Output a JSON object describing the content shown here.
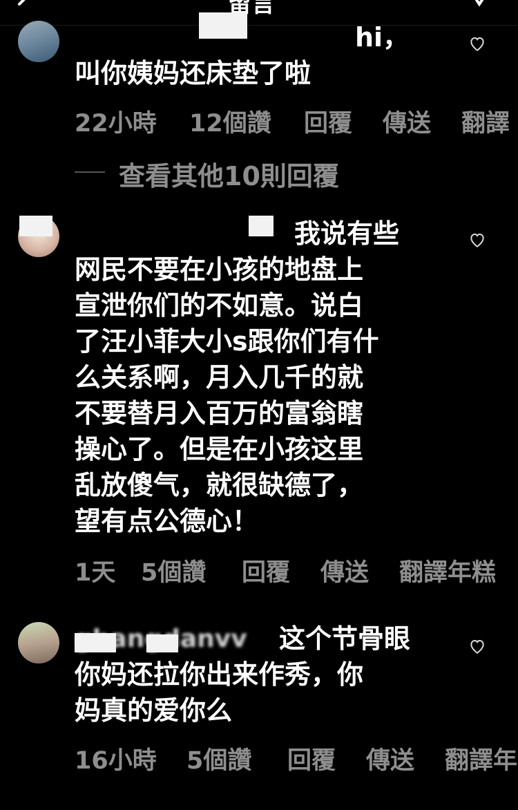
{
  "header": {
    "title": "留言"
  },
  "view_more": "查看其他10則回覆",
  "comments": [
    {
      "lines": [
        "hi，",
        "叫你姨妈还床垫了啦"
      ],
      "meta": {
        "time": "22小時",
        "likes": "12個讚",
        "reply": "回覆",
        "send": "傳送",
        "translate": "翻譯"
      }
    },
    {
      "lines": [
        "我说有些",
        "网民不要在小孩的地盘上",
        "宣泄你们的不如意。说白",
        "了汪小菲大小s跟你们有什",
        "么关系啊，月入几千的就",
        "不要替月入百万的富翁瞎",
        "操心了。但是在小孩这里",
        "乱放傻气，就很缺德了，",
        "望有点公德心！"
      ],
      "meta": {
        "time": "1天",
        "likes": "5個讚",
        "reply": "回覆",
        "send": "傳送",
        "translate": "翻譯年糕"
      }
    },
    {
      "username_fragment": "ghangdanvv",
      "lines": [
        "这个节骨眼",
        "你妈还拉你出来作秀，你",
        "妈真的爱你么"
      ],
      "meta": {
        "time": "16小時",
        "likes": "5個讚",
        "reply": "回覆",
        "send": "傳送",
        "translate": "翻譯年"
      }
    }
  ]
}
